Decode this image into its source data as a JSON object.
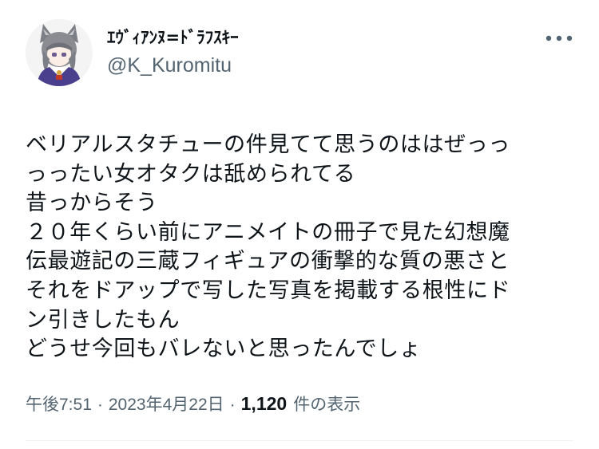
{
  "author": {
    "display_name": "ｴｳﾞｨｱﾝﾇ=ﾄﾞﾗﾌｽｷｰ",
    "handle": "@K_Kuromitu",
    "avatar_icon": "cat-eared-character-avatar"
  },
  "more_icon": "more-options-icon",
  "tweet": {
    "lines": [
      "ベリアルスタチューの件見てて思うのははぜっっ",
      "っったい女オタクは舐められてる",
      "昔っからそう",
      "２０年くらい前にアニメイトの冊子で見た幻想魔",
      "伝最遊記の三蔵フィギュアの衝撃的な質の悪さと",
      "それをドアップで写した写真を掲載する根性にド",
      "ン引きしたもん",
      "どうせ今回もバレないと思ったんでしょ"
    ]
  },
  "meta": {
    "time": "午後7:51",
    "separator": "·",
    "date": "2023年4月22日",
    "separator2": "·",
    "view_count": "1,120",
    "view_label": "件の表示"
  },
  "colors": {
    "text_primary": "#0f1419",
    "text_secondary": "#536471",
    "divider": "#eff3f4"
  }
}
